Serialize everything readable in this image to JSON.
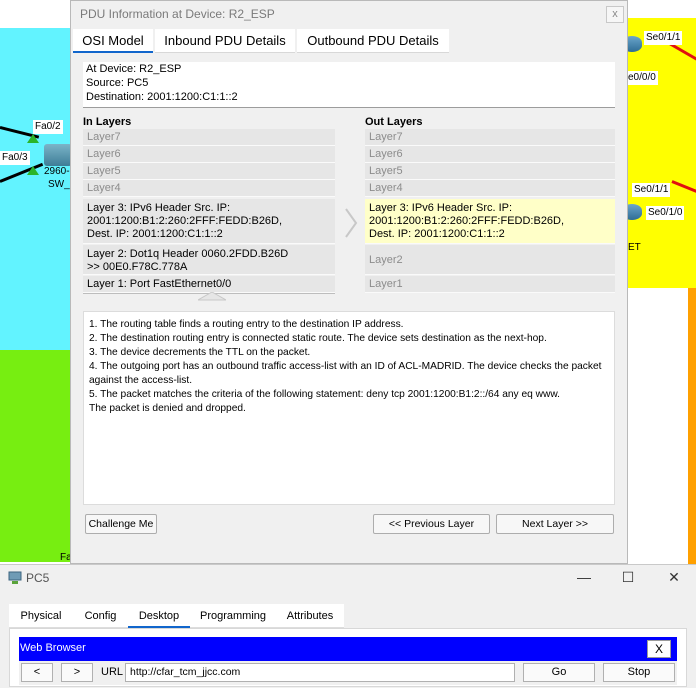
{
  "topology": {
    "labels": {
      "fa0_2": "Fa0/2",
      "fa0_3": "Fa0/3",
      "switch_model": "2960-",
      "switch_name": "SW_",
      "se0_1_1_top": "Se0/1/1",
      "se0_0_0": "e0/0/0",
      "se0_1_1_mid": "Se0/1/1",
      "se0_1_0": "Se0/1/0",
      "et": "ET",
      "fa_bottom": "Fa"
    }
  },
  "pdu_dialog": {
    "title": "PDU Information at Device: R2_ESP",
    "close_label": "x",
    "tabs": [
      {
        "label": "OSI Model",
        "active": true
      },
      {
        "label": "Inbound PDU Details",
        "active": false
      },
      {
        "label": "Outbound PDU Details",
        "active": false
      }
    ],
    "device_info": {
      "device": "At Device: R2_ESP",
      "source": "Source: PC5",
      "destination": "Destination: 2001:1200:C1:1::2"
    },
    "in_layers": {
      "heading": "In Layers",
      "layer7": "Layer7",
      "layer6": "Layer6",
      "layer5": "Layer5",
      "layer4": "Layer4",
      "layer3": [
        "Layer 3: IPv6 Header Src. IP:",
        "2001:1200:B1:2:260:2FFF:FEDD:B26D,",
        "Dest. IP: 2001:1200:C1:1::2"
      ],
      "layer2": [
        "Layer 2: Dot1q Header 0060.2FDD.B26D",
        ">> 00E0.F78C.778A"
      ],
      "layer1": "Layer 1: Port FastEthernet0/0"
    },
    "out_layers": {
      "heading": "Out Layers",
      "layer7": "Layer7",
      "layer6": "Layer6",
      "layer5": "Layer5",
      "layer4": "Layer4",
      "layer3": [
        "Layer 3: IPv6 Header Src. IP:",
        "2001:1200:B1:2:260:2FFF:FEDD:B26D,",
        "Dest. IP: 2001:1200:C1:1::2"
      ],
      "layer2": "Layer2",
      "layer1": "Layer1"
    },
    "steps": [
      "1. The routing table finds a routing entry to the destination IP address.",
      "2. The destination routing entry is connected static route. The device sets destination as the next-hop.",
      "3. The device decrements the TTL on the packet.",
      "4. The outgoing port has an outbound traffic access-list with an ID of ACL-MADRID. The device checks the packet against the access-list.",
      "5. The packet matches the criteria of the following statement: deny tcp 2001:1200:B1:2::/64 any eq www.",
      "The packet is denied and dropped."
    ],
    "buttons": {
      "challenge": "Challenge Me",
      "previous": "<< Previous Layer",
      "next": "Next Layer >>"
    }
  },
  "pc5_window": {
    "title": "PC5",
    "controls": {
      "minimize": "—",
      "maximize": "☐",
      "close": "✕"
    },
    "tabs": [
      {
        "label": "Physical",
        "active": false
      },
      {
        "label": "Config",
        "active": false
      },
      {
        "label": "Desktop",
        "active": true
      },
      {
        "label": "Programming",
        "active": false
      },
      {
        "label": "Attributes",
        "active": false
      }
    ],
    "web_browser": {
      "title": "Web Browser",
      "close_label": "X",
      "back_label": "<",
      "forward_label": ">",
      "url_label": "URL",
      "url_value": "http://cfar_tcm_jjcc.com",
      "go_label": "Go",
      "stop_label": "Stop"
    }
  },
  "colors": {
    "accent": "#1166cc",
    "browser_bar": "#0000ff",
    "active_out_layer": "#ffffc8",
    "area_cyan": "#62f3ff",
    "area_yellow": "#ffff00",
    "area_green": "#77ee11",
    "area_orange": "#ffa000"
  }
}
